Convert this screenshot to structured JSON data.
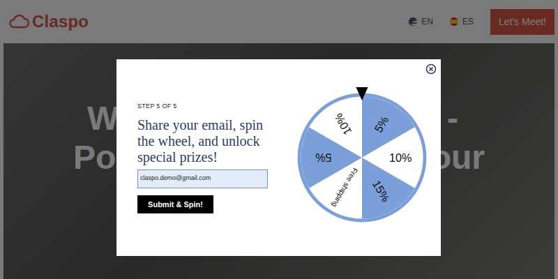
{
  "header": {
    "logo": "Claspo",
    "languages": [
      {
        "label": "EN",
        "kind": "us"
      },
      {
        "label": "ES",
        "kind": "es"
      }
    ],
    "cta": "Let's Meet!"
  },
  "hero": {
    "left_fragments": [
      "W",
      "Po"
    ],
    "right_fragments": [
      "-",
      "our"
    ]
  },
  "modal": {
    "step": "STEP 5 OF 5",
    "heading": "Share your email, spin the wheel, and unlock special prizes!",
    "email": {
      "value": "claspo.demo@gmail.com"
    },
    "submit": "Submit & Spin!"
  },
  "wheel": {
    "segments": [
      {
        "label": "5%",
        "color": "#7b9fd8"
      },
      {
        "label": "10%",
        "color": "#ffffff"
      },
      {
        "label": "15%",
        "color": "#7b9fd8"
      },
      {
        "label": "Free shipping",
        "color": "#ffffff"
      },
      {
        "label": "5%",
        "color": "#7b9fd8"
      },
      {
        "label": "10%",
        "color": "#ffffff"
      }
    ]
  }
}
